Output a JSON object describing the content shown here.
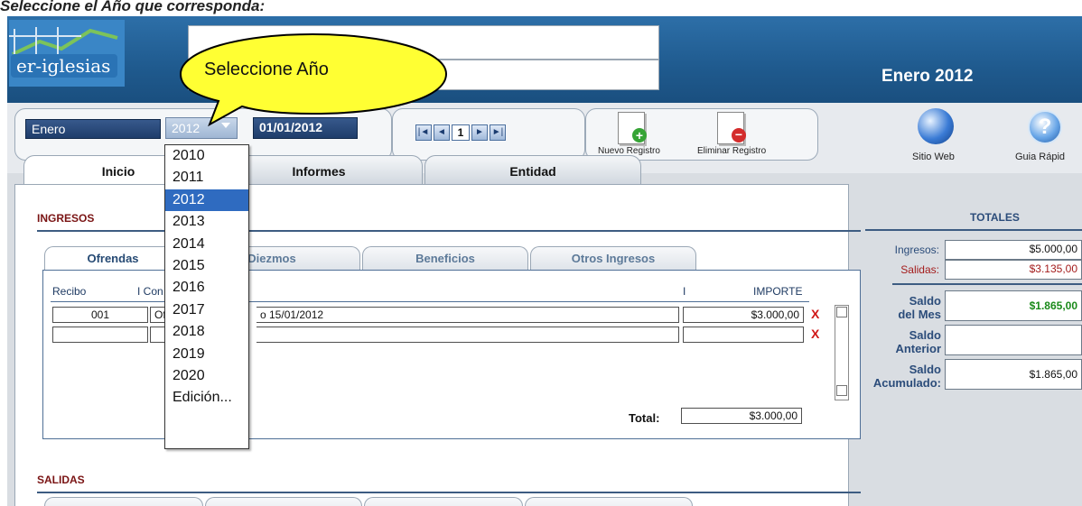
{
  "intro": "Seleccione el Año que corresponda:",
  "header": {
    "logo_text": "er-iglesias",
    "month_title": "Enero 2012"
  },
  "callout": "Seleccione Año",
  "controls": {
    "month": "Enero",
    "year": "2012",
    "date": "01/01/2012",
    "record_number": "1",
    "new_record": "Nuevo Registro",
    "delete_record": "Eliminar Registro",
    "site_web": "Sitio Web",
    "guide": "Guia Rápid"
  },
  "tabs": [
    "Inicio",
    "Informes",
    "Entidad"
  ],
  "ingresos": {
    "title": "INGRESOS",
    "subtabs": [
      "Ofrendas",
      "Diezmos",
      "Beneficios",
      "Otros Ingresos"
    ],
    "col_recibo": "Recibo",
    "col_concepto": "I Con",
    "col_sep": "I",
    "col_importe": "IMPORTE",
    "rows": [
      {
        "recibo": "001",
        "concepto_a": "Ofre",
        "concepto_b": "o 15/01/2012",
        "importe": "$3.000,00",
        "delete": "X"
      },
      {
        "recibo": "",
        "concepto_a": "",
        "concepto_b": "",
        "importe": "",
        "delete": "X"
      }
    ],
    "total_label": "Total:",
    "total_value": "$3.000,00"
  },
  "salidas": {
    "title": "SALIDAS"
  },
  "totales": {
    "title": "TOTALES",
    "ingresos_label": "Ingresos:",
    "ingresos_value": "$5.000,00",
    "salidas_label": "Salidas:",
    "salidas_value": "$3.135,00",
    "saldo_mes_label_1": "Saldo",
    "saldo_mes_label_2": "del Mes",
    "saldo_mes_value": "$1.865,00",
    "saldo_ant_label_1": "Saldo",
    "saldo_ant_label_2": "Anterior",
    "saldo_acum_label_1": "Saldo",
    "saldo_acum_label_2": "Acumulado:",
    "saldo_acum_value": "$1.865,00"
  },
  "year_options": [
    "2010",
    "2011",
    "2012",
    "2013",
    "2014",
    "2015",
    "2016",
    "2017",
    "2018",
    "2019",
    "2020",
    "Edición..."
  ],
  "selected_year": "2012",
  "colors": {
    "header": "#1f5a8e",
    "callout": "#ffff33",
    "selected": "#2f6bc0",
    "delete": "#d01818",
    "saldo_mes": "#1a8a1a"
  }
}
